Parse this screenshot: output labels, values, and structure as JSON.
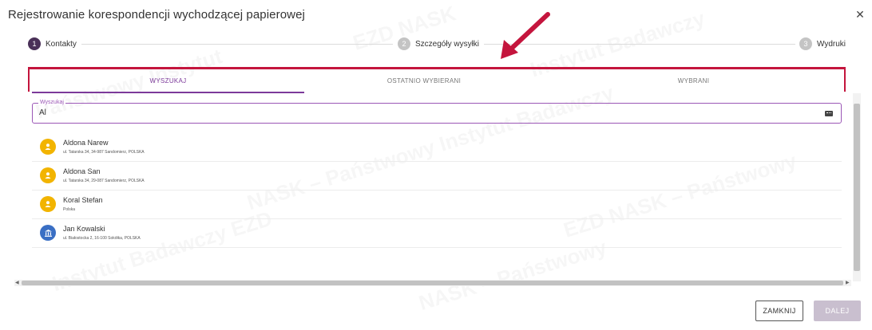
{
  "dialog": {
    "title": "Rejestrowanie korespondencji wychodzącej papierowej"
  },
  "stepper": {
    "steps": [
      {
        "number": "1",
        "label": "Kontakty"
      },
      {
        "number": "2",
        "label": "Szczegóły wysyłki"
      },
      {
        "number": "3",
        "label": "Wydruki"
      }
    ]
  },
  "tabs": [
    {
      "label": "WYSZUKAJ"
    },
    {
      "label": "OSTATNIO WYBIERANI"
    },
    {
      "label": "WYBRANI"
    }
  ],
  "search": {
    "label": "Wyszukaj",
    "value": "Al"
  },
  "contacts": [
    {
      "name": "Aldona Narew",
      "address": "ul. Tatarska 34, 34-987 Sandomierz, POLSKA",
      "icon": "person-icon"
    },
    {
      "name": "Aldona San",
      "address": "ul. Tatarska 34, 29-087 Sandomierz, POLSKA",
      "icon": "person-icon"
    },
    {
      "name": "Koral Stefan",
      "address": "Polska",
      "icon": "person-icon"
    },
    {
      "name": "Jan Kowalski",
      "address": "ul. Białostocka 2, 16-100 Sokółka, POLSKA",
      "icon": "institution-icon"
    }
  ],
  "buttons": {
    "close": "ZAMKNIJ",
    "next": "DALEJ"
  },
  "colors": {
    "accent": "#7c3a9a",
    "highlight": "#c4153d",
    "person_avatar": "#f2b400",
    "institution_avatar": "#3a6fc4"
  }
}
